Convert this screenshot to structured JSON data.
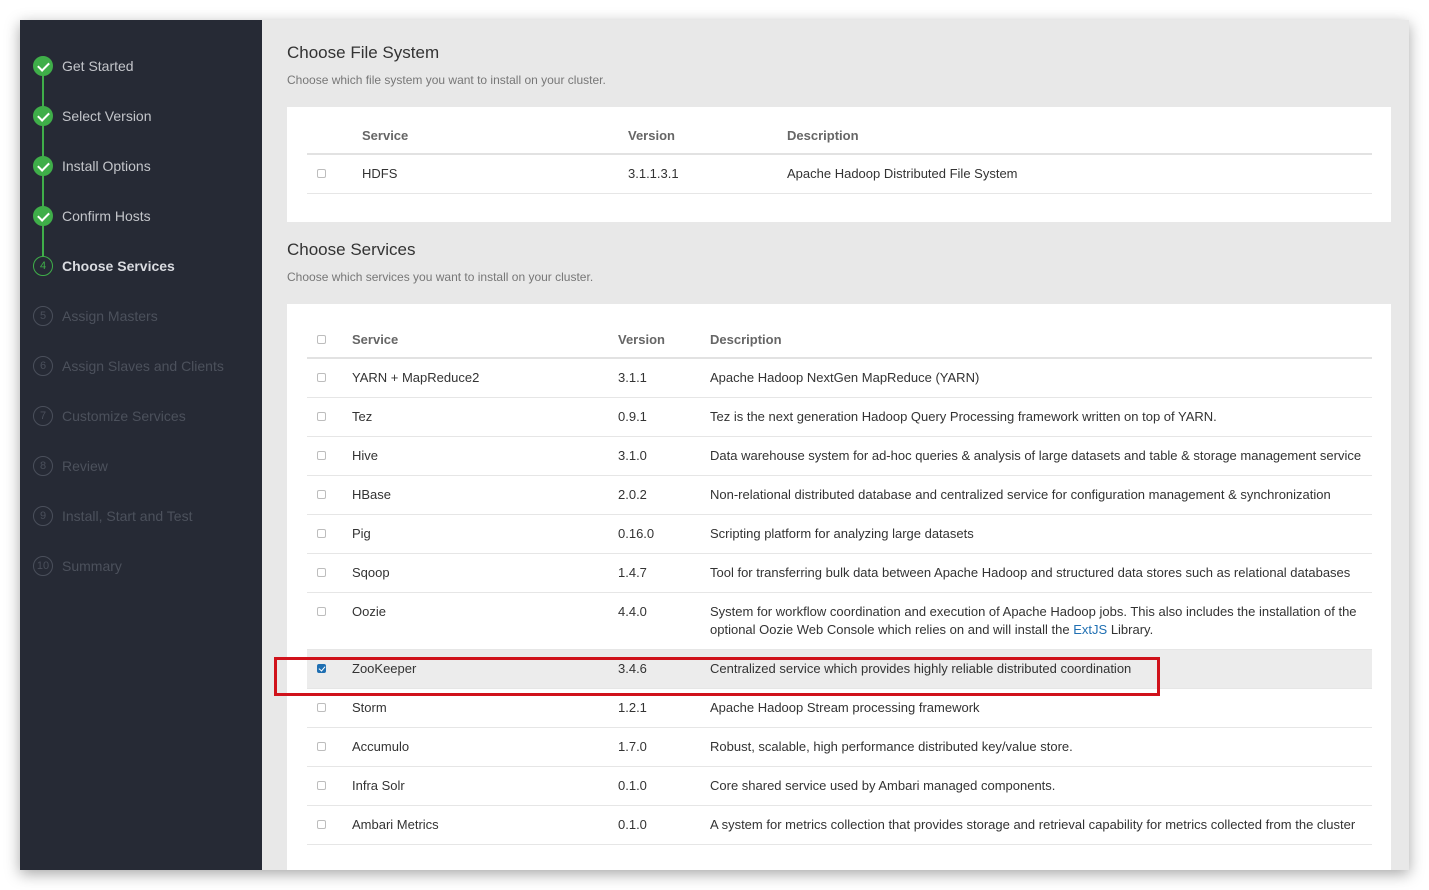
{
  "sidebar": {
    "steps": [
      {
        "marker": "",
        "label": "Get Started",
        "state": "done"
      },
      {
        "marker": "",
        "label": "Select Version",
        "state": "done"
      },
      {
        "marker": "",
        "label": "Install Options",
        "state": "done"
      },
      {
        "marker": "",
        "label": "Confirm Hosts",
        "state": "done"
      },
      {
        "marker": "4",
        "label": "Choose Services",
        "state": "active"
      },
      {
        "marker": "5",
        "label": "Assign Masters",
        "state": "todo"
      },
      {
        "marker": "6",
        "label": "Assign Slaves and Clients",
        "state": "todo"
      },
      {
        "marker": "7",
        "label": "Customize Services",
        "state": "todo"
      },
      {
        "marker": "8",
        "label": "Review",
        "state": "todo"
      },
      {
        "marker": "9",
        "label": "Install, Start and Test",
        "state": "todo"
      },
      {
        "marker": "10",
        "label": "Summary",
        "state": "todo"
      }
    ]
  },
  "file_system": {
    "title": "Choose File System",
    "subtitle": "Choose which file system you want to install on your cluster.",
    "headers": {
      "service": "Service",
      "version": "Version",
      "description": "Description"
    },
    "rows": [
      {
        "service": "HDFS",
        "version": "3.1.1.3.1",
        "description": "Apache Hadoop Distributed File System",
        "checked": false
      }
    ]
  },
  "services": {
    "title": "Choose Services",
    "subtitle": "Choose which services you want to install on your cluster.",
    "headers": {
      "service": "Service",
      "version": "Version",
      "description": "Description"
    },
    "rows": [
      {
        "service": "YARN + MapReduce2",
        "version": "3.1.1",
        "description": "Apache Hadoop NextGen MapReduce (YARN)",
        "checked": false
      },
      {
        "service": "Tez",
        "version": "0.9.1",
        "description": "Tez is the next generation Hadoop Query Processing framework written on top of YARN.",
        "checked": false
      },
      {
        "service": "Hive",
        "version": "3.1.0",
        "description": "Data warehouse system for ad-hoc queries & analysis of large datasets and table & storage management service",
        "checked": false
      },
      {
        "service": "HBase",
        "version": "2.0.2",
        "description": "Non-relational distributed database and centralized service for configuration management & synchronization",
        "checked": false
      },
      {
        "service": "Pig",
        "version": "0.16.0",
        "description": "Scripting platform for analyzing large datasets",
        "checked": false
      },
      {
        "service": "Sqoop",
        "version": "1.4.7",
        "description": "Tool for transferring bulk data between Apache Hadoop and structured data stores such as relational databases",
        "checked": false
      },
      {
        "service": "Oozie",
        "version": "4.4.0",
        "description": "System for workflow coordination and execution of Apache Hadoop jobs. This also includes the installation of the optional Oozie Web Console which relies on and will install the ",
        "link": "ExtJS",
        "description_suffix": " Library.",
        "checked": false
      },
      {
        "service": "ZooKeeper",
        "version": "3.4.6",
        "description": "Centralized service which provides highly reliable distributed coordination",
        "checked": true
      },
      {
        "service": "Storm",
        "version": "1.2.1",
        "description": "Apache Hadoop Stream processing framework",
        "checked": false
      },
      {
        "service": "Accumulo",
        "version": "1.7.0",
        "description": "Robust, scalable, high performance distributed key/value store.",
        "checked": false
      },
      {
        "service": "Infra Solr",
        "version": "0.1.0",
        "description": "Core shared service used by Ambari managed components.",
        "checked": false
      },
      {
        "service": "Ambari Metrics",
        "version": "0.1.0",
        "description": "A system for metrics collection that provides storage and retrieval capability for metrics collected from the cluster",
        "checked": false
      }
    ]
  },
  "colors": {
    "accent_green": "#3fae49",
    "sidebar_bg": "#262a35",
    "highlight_red": "#d0121b",
    "link_blue": "#1f6fb2"
  }
}
